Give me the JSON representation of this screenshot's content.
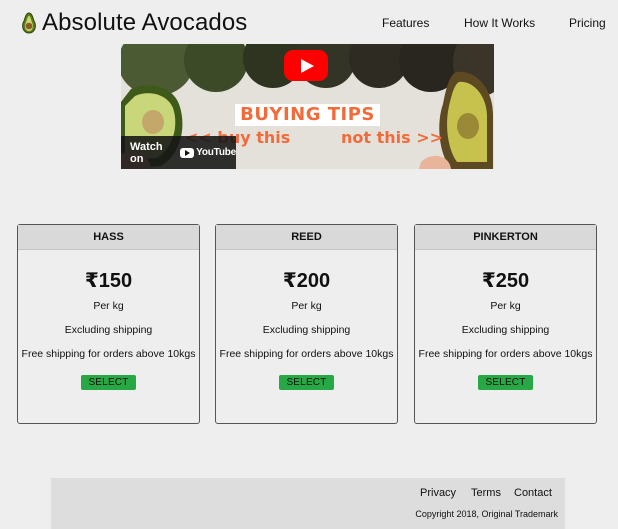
{
  "header": {
    "brand_name": "Absolute Avocados",
    "logo_icon": "avocado-icon",
    "nav": [
      "Features",
      "How It Works",
      "Pricing"
    ]
  },
  "video": {
    "banner_text": "BUYING TIPS",
    "left_caption": "<< buy this",
    "right_caption": "not this >>",
    "watch_label": "Watch on",
    "platform_label": "YouTube",
    "play_icon": "play-icon",
    "accent_color": "#f26b3a"
  },
  "pricing": {
    "currency_symbol": "₹",
    "plans": [
      {
        "name": "HASS",
        "price": "₹150",
        "unit": "Per kg",
        "shipping": "Excluding shipping",
        "free_shipping": "Free shipping for orders above 10kgs",
        "button": "SELECT"
      },
      {
        "name": "REED",
        "price": "₹200",
        "unit": "Per kg",
        "shipping": "Excluding shipping",
        "free_shipping": "Free shipping for orders above 10kgs",
        "button": "SELECT"
      },
      {
        "name": "PINKERTON",
        "price": "₹250",
        "unit": "Per kg",
        "shipping": "Excluding shipping",
        "free_shipping": "Free shipping for orders above 10kgs",
        "button": "SELECT"
      }
    ],
    "button_color": "#27a844"
  },
  "footer": {
    "links": [
      "Privacy",
      "Terms",
      "Contact"
    ],
    "copyright": "Copyright 2018, Original Trademark"
  }
}
